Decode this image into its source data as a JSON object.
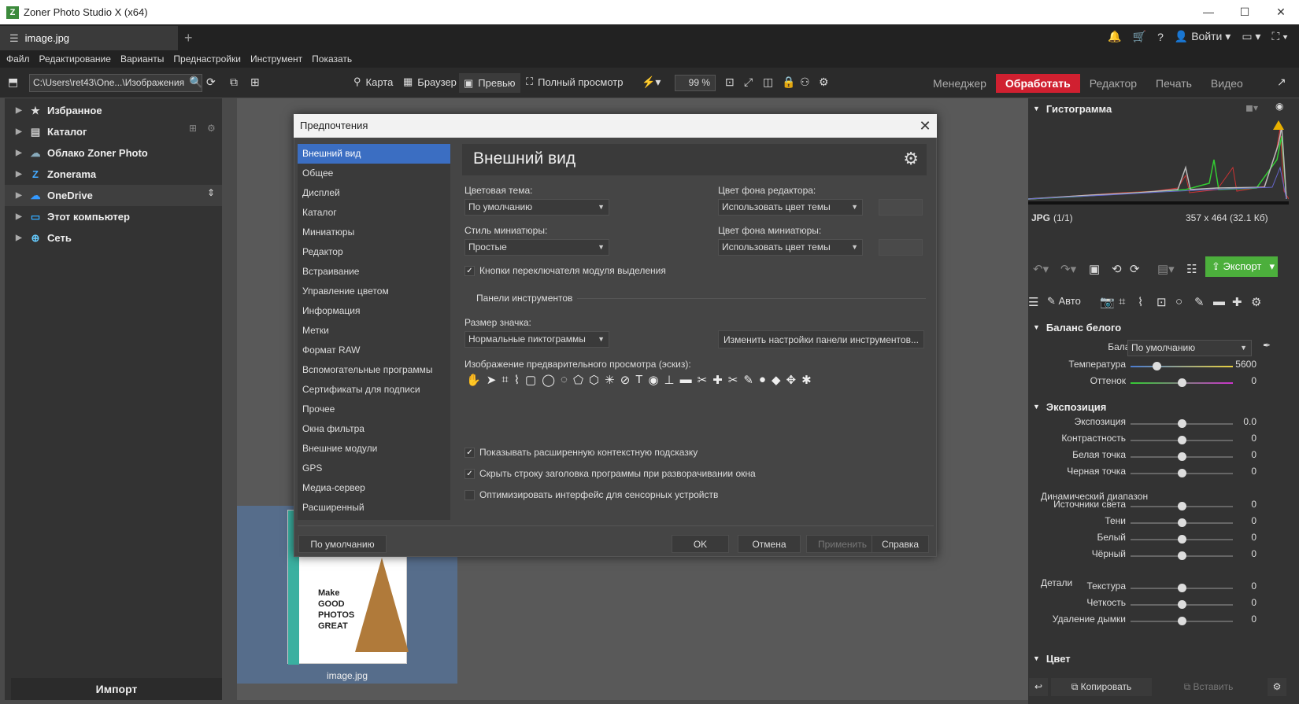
{
  "window": {
    "title": "Zoner Photo Studio X (x64)",
    "app_icon_label": "Z",
    "min": "—",
    "max": "☐",
    "close": "✕"
  },
  "tab": {
    "label": "image.jpg",
    "icon": "sliders-icon"
  },
  "account": {
    "login": "Войти"
  },
  "menu": [
    "Файл",
    "Редактирование",
    "Варианты",
    "Преднастройки",
    "Инструмент",
    "Показать"
  ],
  "toolbar": {
    "path": "C:\\Users\\ret43\\One...\\Изображения",
    "map": "Карта",
    "browser": "Браузер",
    "preview": "Превью",
    "fullview": "Полный просмотр",
    "zoom": "99 %"
  },
  "modes": {
    "manager": "Менеджер",
    "process": "Обработать",
    "editor": "Редактор",
    "print": "Печать",
    "video": "Видео"
  },
  "tree": [
    {
      "label": "Избранное",
      "icon": "★"
    },
    {
      "label": "Каталог",
      "icon": "▤"
    },
    {
      "label": "Облако Zoner Photo",
      "icon": "☁"
    },
    {
      "label": "Zonerama",
      "icon": "Z"
    },
    {
      "label": "OneDrive",
      "icon": "☁"
    },
    {
      "label": "Этот компьютер",
      "icon": "▭"
    },
    {
      "label": "Сеть",
      "icon": "⊕"
    }
  ],
  "import_label": "Импорт",
  "thumbnail": {
    "name": "image.jpg",
    "text": "Make\nGOOD\nPHOTOS\nGREAT"
  },
  "dialog": {
    "title": "Предпочтения",
    "categories": [
      "Внешний вид",
      "Общее",
      "Дисплей",
      "Каталог",
      "Миниатюры",
      "Редактор",
      "Встраивание",
      "Управление цветом",
      "Информация",
      "Метки",
      "Формат RAW",
      "Вспомогательные программы",
      "Сертификаты для подписи",
      "Прочее",
      "Окна фильтра",
      "Внешние модули",
      "GPS",
      "Медиа-сервер",
      "Расширенный"
    ],
    "heading": "Внешний вид",
    "color_theme_label": "Цветовая тема:",
    "color_theme_value": "По умолчанию",
    "editor_bg_label": "Цвет фона редактора:",
    "editor_bg_value": "Использовать цвет темы",
    "thumb_style_label": "Стиль миниатюры:",
    "thumb_style_value": "Простые",
    "thumb_bg_label": "Цвет фона миниатюры:",
    "thumb_bg_value": "Использовать цвет темы",
    "chk_selection_switch": "Кнопки переключателя модуля выделения",
    "toolbars_section": "Панели инструментов",
    "icon_size_label": "Размер значка:",
    "icon_size_value": "Нормальные пиктограммы",
    "change_toolbar_btn": "Изменить настройки панели инструментов...",
    "preview_label": "Изображение предварительного просмотра (эскиз):",
    "chk_extended_tooltip": "Показывать расширенную контекстную подсказку",
    "chk_hide_titlebar": "Скрыть строку заголовка программы при разворачивании окна",
    "chk_touch": "Оптимизировать интерфейс для сенсорных устройств",
    "defaults_btn": "По умолчанию",
    "ok": "OK",
    "cancel": "Отмена",
    "apply": "Применить",
    "help": "Справка"
  },
  "right": {
    "histogram_title": "Гистограмма",
    "format": "JPG",
    "count": "(1/1)",
    "dims": "357 x 464 (32.1 Кб)",
    "export": "Экспорт",
    "auto": "Авто",
    "wb_section": "Баланс белого",
    "wb_label": "Баланс белого",
    "wb_value": "По умолчанию",
    "exposure_section": "Экспозиция",
    "dynamic_range": "Динамический диапазон",
    "details": "Детали",
    "color_section": "Цвет",
    "copy": "Копировать",
    "paste": "Вставить",
    "sliders": [
      {
        "label": "Температура",
        "value": "5600",
        "pos": 0.25
      },
      {
        "label": "Оттенок",
        "value": "0",
        "pos": 0.5
      },
      {
        "label": "Экспозиция",
        "value": "0.0",
        "pos": 0.5
      },
      {
        "label": "Контрастность",
        "value": "0",
        "pos": 0.5
      },
      {
        "label": "Белая точка",
        "value": "0",
        "pos": 0.5
      },
      {
        "label": "Черная точка",
        "value": "0",
        "pos": 0.5
      },
      {
        "label": "Источники света",
        "value": "0",
        "pos": 0.5
      },
      {
        "label": "Тени",
        "value": "0",
        "pos": 0.5
      },
      {
        "label": "Белый",
        "value": "0",
        "pos": 0.5
      },
      {
        "label": "Чёрный",
        "value": "0",
        "pos": 0.5
      },
      {
        "label": "Текстура",
        "value": "0",
        "pos": 0.5
      },
      {
        "label": "Четкость",
        "value": "0",
        "pos": 0.5
      },
      {
        "label": "Удаление дымки",
        "value": "0",
        "pos": 0.5
      }
    ]
  }
}
